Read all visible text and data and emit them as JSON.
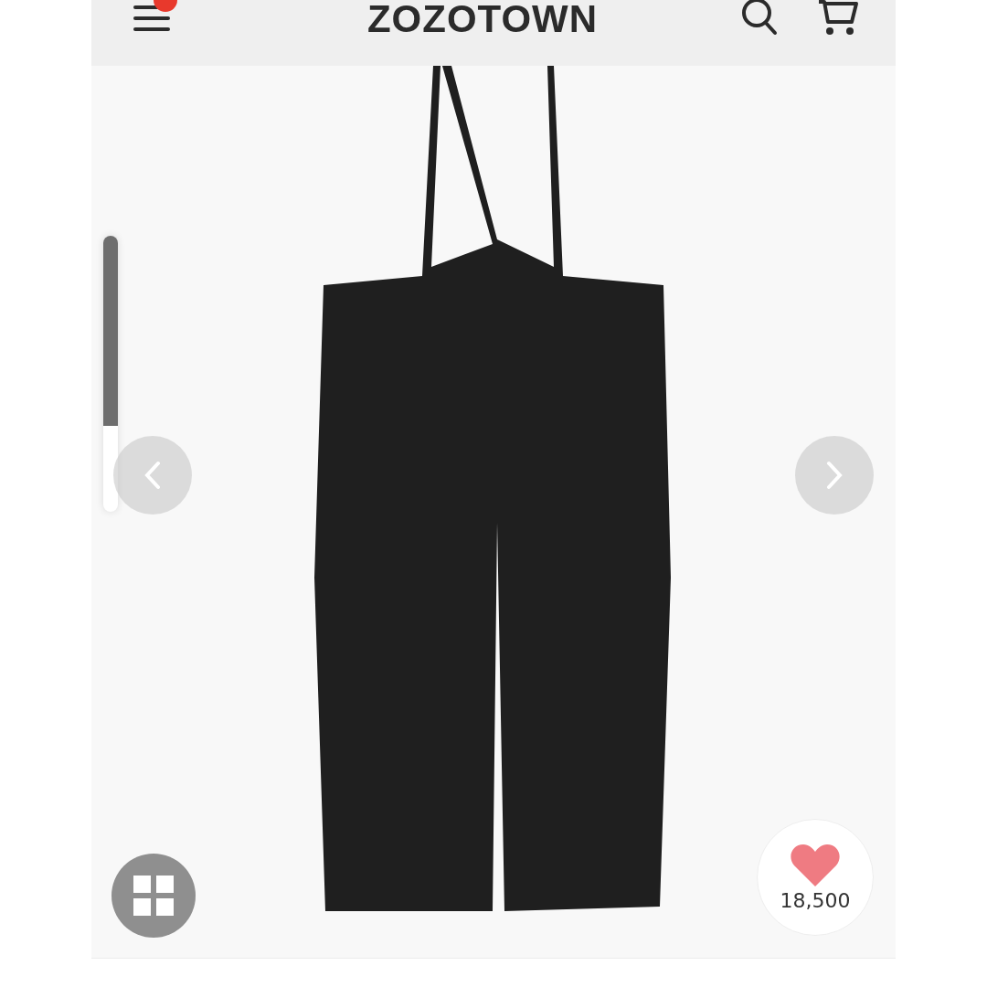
{
  "header": {
    "logo": "ZOZOTOWN",
    "menu_badge": true
  },
  "favorite": {
    "count": "18,500"
  }
}
